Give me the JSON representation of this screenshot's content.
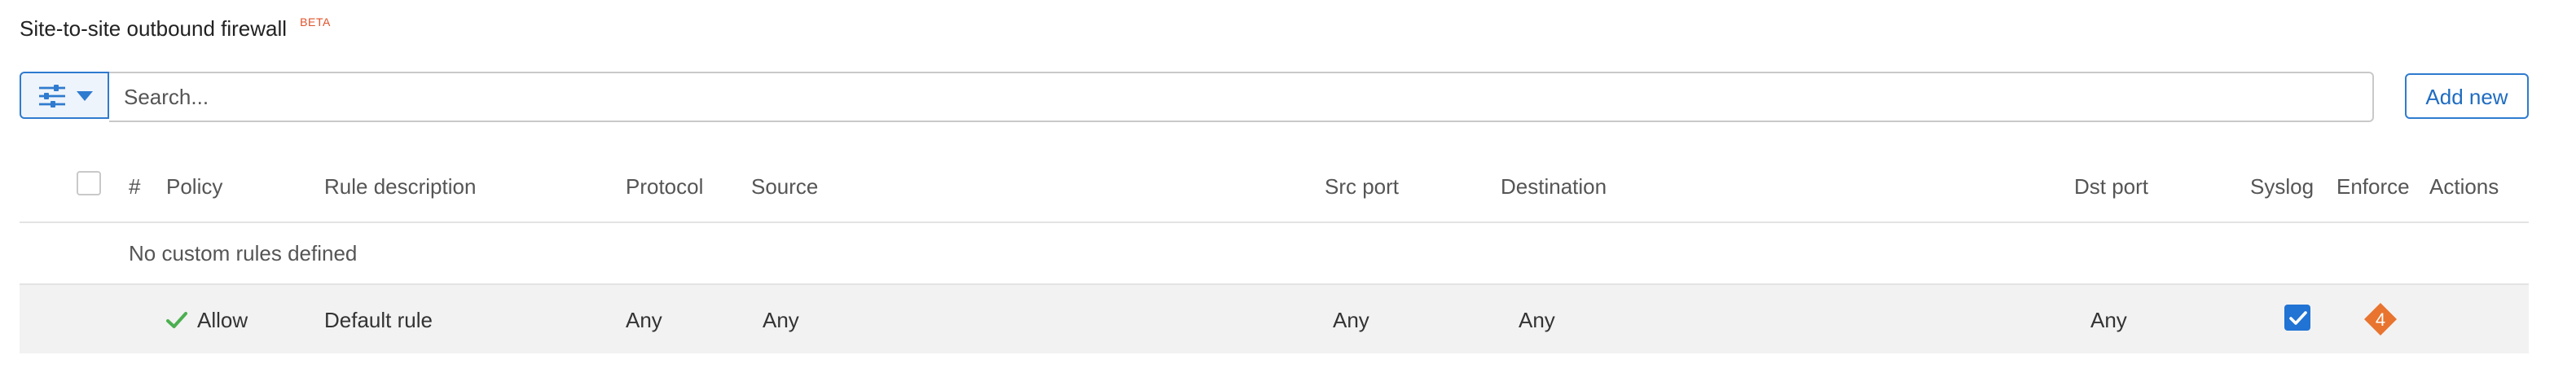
{
  "header": {
    "title": "Site-to-site outbound firewall",
    "beta": "BETA"
  },
  "toolbar": {
    "filter_icon": "sliders-icon",
    "search_placeholder": "Search...",
    "add_new_label": "Add new"
  },
  "table": {
    "columns": {
      "number": "#",
      "policy": "Policy",
      "description": "Rule description",
      "protocol": "Protocol",
      "source": "Source",
      "src_port": "Src port",
      "destination": "Destination",
      "dst_port": "Dst port",
      "syslog": "Syslog",
      "enforce": "Enforce",
      "actions": "Actions"
    },
    "empty_message": "No custom rules defined",
    "default_rule": {
      "policy": "Allow",
      "description": "Default rule",
      "protocol": "Any",
      "source": "Any",
      "src_port": "Any",
      "destination": "Any",
      "dst_port": "Any",
      "syslog_checked": true,
      "enforce_count": "4"
    }
  },
  "colors": {
    "accent": "#2f7bcf",
    "beta": "#e0522b",
    "allow_check": "#4caf50",
    "enforce_badge": "#e8742f",
    "row_bg": "#f2f2f2"
  }
}
